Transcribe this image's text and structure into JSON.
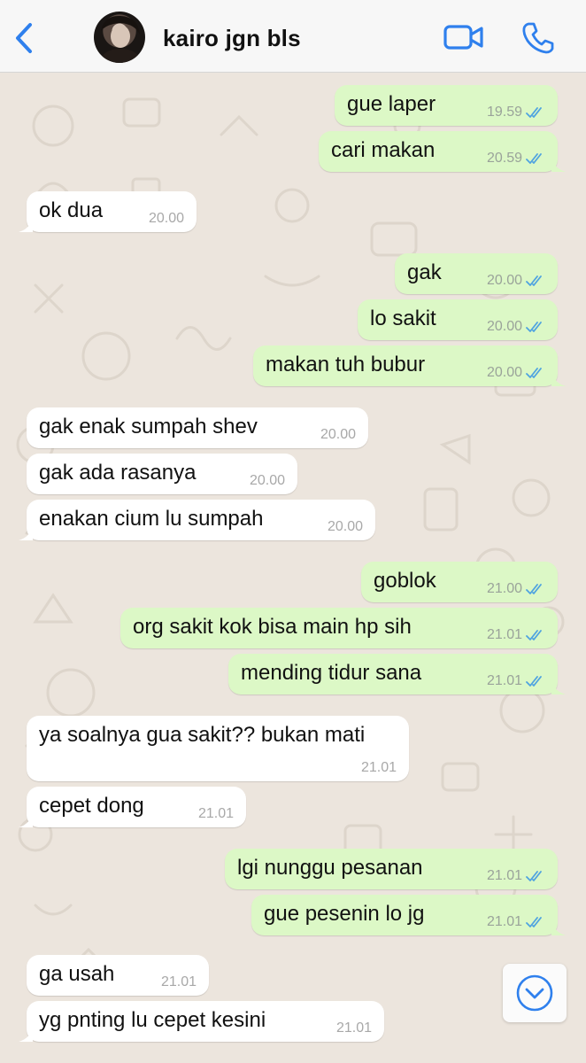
{
  "header": {
    "contact_name": "kairo jgn bls",
    "back_icon": "chevron-left-icon",
    "video_icon": "video-camera-icon",
    "call_icon": "phone-icon",
    "accent": "#2f80ed"
  },
  "colors": {
    "outgoing_bubble": "#dcf8c6",
    "incoming_bubble": "#ffffff",
    "read_ticks": "#4fa3e0",
    "wallpaper": "#ece5dd"
  },
  "messages": [
    {
      "dir": "out",
      "text": "gue laper",
      "time": "19.59",
      "read": true
    },
    {
      "dir": "out",
      "text": "cari makan",
      "time": "20.59",
      "read": true
    },
    {
      "dir": "in",
      "text": "ok dua",
      "time": "20.00"
    },
    {
      "dir": "out",
      "text": "gak",
      "time": "20.00",
      "read": true
    },
    {
      "dir": "out",
      "text": "lo sakit",
      "time": "20.00",
      "read": true
    },
    {
      "dir": "out",
      "text": "makan tuh bubur",
      "time": "20.00",
      "read": true
    },
    {
      "dir": "in",
      "text": "gak enak sumpah shev",
      "time": "20.00"
    },
    {
      "dir": "in",
      "text": "gak ada rasanya",
      "time": "20.00"
    },
    {
      "dir": "in",
      "text": "enakan cium lu sumpah",
      "time": "20.00"
    },
    {
      "dir": "out",
      "text": "goblok",
      "time": "21.00",
      "read": true
    },
    {
      "dir": "out",
      "text": "org sakit kok bisa main hp sih",
      "time": "21.01",
      "read": true
    },
    {
      "dir": "out",
      "text": "mending tidur sana",
      "time": "21.01",
      "read": true
    },
    {
      "dir": "in",
      "text": "ya soalnya gua sakit?? bukan mati",
      "time": "21.01"
    },
    {
      "dir": "in",
      "text": "cepet dong",
      "time": "21.01"
    },
    {
      "dir": "out",
      "text": "lgi nunggu pesanan",
      "time": "21.01",
      "read": true
    },
    {
      "dir": "out",
      "text": "gue pesenin lo jg",
      "time": "21.01",
      "read": true
    },
    {
      "dir": "in",
      "text": "ga usah",
      "time": "21.01"
    },
    {
      "dir": "in",
      "text": "yg pnting lu cepet kesini",
      "time": "21.01"
    }
  ],
  "scroll_button_icon": "chevron-down-circle-icon"
}
